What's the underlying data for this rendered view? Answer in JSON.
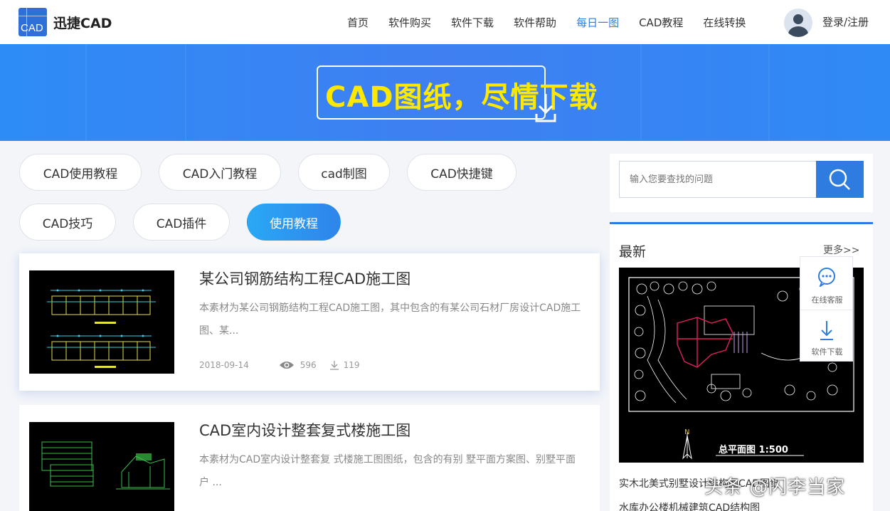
{
  "header": {
    "logo_text": "迅捷CAD",
    "logo_box_label": "CAD",
    "nav": [
      "首页",
      "软件购买",
      "软件下载",
      "软件帮助",
      "每日一图",
      "CAD教程",
      "在线转换"
    ],
    "active_nav": "每日一图",
    "login_label": "登录/注册"
  },
  "banner": {
    "slogan": "CAD图纸，尽情下载"
  },
  "tags": [
    "CAD使用教程",
    "CAD入门教程",
    "cad制图",
    "CAD快捷键",
    "CAD技巧",
    "CAD插件",
    "使用教程"
  ],
  "active_tag": "使用教程",
  "articles": [
    {
      "title": "某公司钢筋结构工程CAD施工图",
      "desc": "本素材为某公司钢筋结构工程CAD施工图，其中包含的有某公司石材厂房设计CAD施工图、某...",
      "date": "2018-09-14",
      "views": "596",
      "downloads": "119"
    },
    {
      "title": "CAD室内设计整套复式楼施工图",
      "desc": "本素材为CAD室内设计整套复 式楼施工图图纸，包含的有别 墅平面方案图、别墅平面户 ..."
    }
  ],
  "search": {
    "placeholder": "输入您要查找的问题"
  },
  "latest": {
    "title": "最新",
    "more": "更多>>",
    "plan_caption": "总平面图 1:500",
    "north_label": "N",
    "items": [
      "实木北美式别墅设计结构图CAD图纸",
      "水库办公楼机械建筑CAD结构图"
    ]
  },
  "float_menu": {
    "service": "在线客服",
    "download": "软件下载"
  },
  "watermark": "头条 @闪李当家",
  "colors": {
    "accent": "#2f7ce0",
    "banner_text": "#ffe800"
  }
}
